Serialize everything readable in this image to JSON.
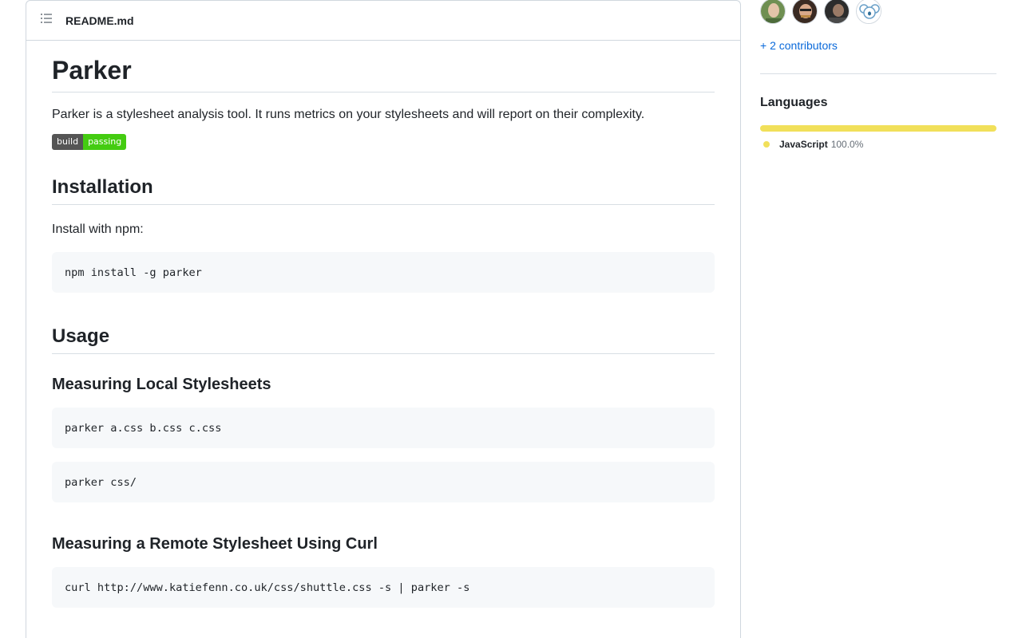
{
  "readme": {
    "filename": "README.md",
    "title": "Parker",
    "description": "Parker is a stylesheet analysis tool. It runs metrics on your stylesheets and will report on their complexity.",
    "badge": {
      "left": "build",
      "right": "passing",
      "left_color": "#555555",
      "right_color": "#44cc11"
    },
    "installation": {
      "heading": "Installation",
      "intro": "Install with npm:",
      "code": "npm install -g parker"
    },
    "usage": {
      "heading": "Usage",
      "local": {
        "heading": "Measuring Local Stylesheets",
        "code1": "parker a.css b.css c.css",
        "code2": "parker css/"
      },
      "remote": {
        "heading": "Measuring a Remote Stylesheet Using Curl",
        "code": "curl http://www.katiefenn.co.uk/css/shuttle.css -s | parker -s"
      }
    }
  },
  "sidebar": {
    "contributors_link": "+ 2 contributors",
    "languages": {
      "title": "Languages",
      "items": [
        {
          "name": "JavaScript",
          "percent": "100.0%",
          "fraction": 1.0,
          "color": "#f1e05a"
        }
      ]
    }
  }
}
